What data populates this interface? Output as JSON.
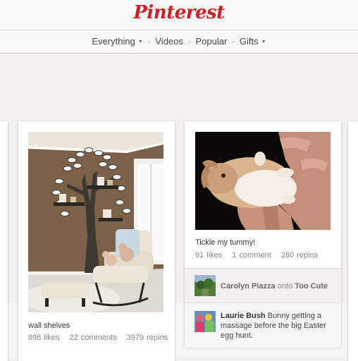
{
  "header": {
    "logo": "Pinterest"
  },
  "nav": {
    "items": [
      {
        "label": "Everything",
        "has_dropdown": true
      },
      {
        "label": "Videos",
        "has_dropdown": false
      },
      {
        "label": "Popular",
        "has_dropdown": false
      },
      {
        "label": "Gifts",
        "has_dropdown": true
      }
    ],
    "separator": "·"
  },
  "pins": [
    {
      "image": "nursery room with tree wall decal shelves and rocking chair",
      "description": "wall shelves",
      "likes": "898 likes",
      "comments": "22 comments",
      "repins": "3979 repins"
    },
    {
      "image": "baby bunny held on its back in hands",
      "description": "Tickle my tummy!",
      "likes": "91 likes",
      "comments": "1 comment",
      "repins": "260 repins",
      "activity": [
        {
          "user": "Carolyn Piazza",
          "connector": "onto",
          "board": "Too Cute"
        },
        {
          "user": "Laurie Bush",
          "text": "Bunny getting a massage before the big Easter egg hunt."
        }
      ]
    }
  ],
  "colors": {
    "brand": "#cb2027",
    "background": "#f2f0f0",
    "card": "#ffffff"
  }
}
